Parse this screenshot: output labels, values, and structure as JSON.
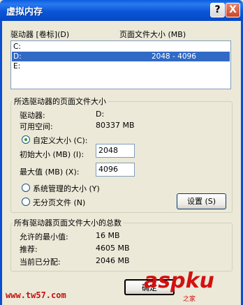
{
  "window": {
    "title": "虚拟内存",
    "help_glyph": "?",
    "close_glyph": "X"
  },
  "drive_list": {
    "header_drive": "驱动器 [卷标](D)",
    "header_size": "页面文件大小 (MB)",
    "rows": [
      {
        "drive": "C:",
        "size": "",
        "selected": false
      },
      {
        "drive": "D:",
        "size": "2048 - 4096",
        "selected": true
      },
      {
        "drive": "E:",
        "size": "",
        "selected": false
      }
    ]
  },
  "selected_drive_group": {
    "legend": "所选驱动器的页面文件大小",
    "drive_label": "驱动器:",
    "drive_value": "D:",
    "space_label": "可用空间:",
    "space_value": "80337 MB",
    "custom_size_label": "自定义大小 (C):",
    "initial_size_label": "初始大小 (MB) (I):",
    "initial_size_value": "2048",
    "max_size_label": "最大值 (MB) (X):",
    "max_size_value": "4096",
    "system_managed_label": "系统管理的大小 (Y)",
    "no_paging_label": "无分页文件 (N)",
    "set_button": "设置 (S)",
    "selected_option": "custom"
  },
  "total_group": {
    "legend": "所有驱动器页面文件大小的总数",
    "min_label": "允许的最小值:",
    "min_value": "16 MB",
    "recommended_label": "推荐:",
    "recommended_value": "4605 MB",
    "current_label": "当前已分配:",
    "current_value": "2046 MB"
  },
  "footer": {
    "ok_button": "确定"
  },
  "overlay": {
    "watermark_url": "www.tw57.com",
    "logo_text": "aspku",
    "logo_tagline": "之家"
  },
  "colors": {
    "titlebar": "#0A56D8",
    "dialog_bg": "#ECE9D8",
    "selection": "#316AC5",
    "watermark": "#C81010"
  }
}
